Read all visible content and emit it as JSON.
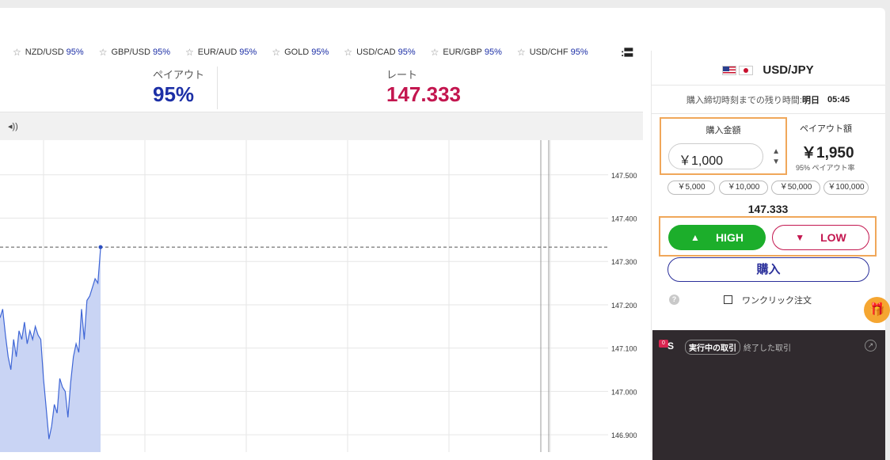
{
  "favorites": [
    {
      "pair": "NZD/USD",
      "payout": "95%"
    },
    {
      "pair": "GBP/USD",
      "payout": "95%"
    },
    {
      "pair": "EUR/AUD",
      "payout": "95%"
    },
    {
      "pair": "GOLD",
      "payout": "95%"
    },
    {
      "pair": "USD/CAD",
      "payout": "95%"
    },
    {
      "pair": "EUR/GBP",
      "payout": "95%"
    },
    {
      "pair": "USD/CHF",
      "payout": "95%"
    }
  ],
  "icons": {
    "star": "☆",
    "menu": ":〓",
    "sound": "🔊",
    "help": "?",
    "gift": "🎁"
  },
  "stats": {
    "payout_label": "ペイアウト",
    "payout_value": "95%",
    "rate_label": "レート",
    "rate_value": "147.333"
  },
  "colors": {
    "payout": "#1c2fa6",
    "rate": "#c3164f",
    "high": "#1cae2b",
    "low": "#c3164f",
    "highlight": "#f0a75a"
  },
  "chart_data": {
    "type": "area",
    "y_ticks": [
      "147.500",
      "147.400",
      "147.300",
      "147.200",
      "147.100",
      "147.000",
      "146.900"
    ],
    "ylim": [
      146.86,
      147.58
    ],
    "current_rate": 147.333,
    "series_values": [
      147.17,
      147.19,
      147.13,
      147.08,
      147.05,
      147.12,
      147.08,
      147.14,
      147.12,
      147.16,
      147.11,
      147.14,
      147.12,
      147.15,
      147.13,
      147.12,
      147.03,
      146.96,
      146.89,
      146.92,
      146.97,
      146.95,
      147.03,
      147.01,
      147.0,
      146.94,
      147.02,
      147.08,
      147.11,
      147.09,
      147.19,
      147.12,
      147.21,
      147.22,
      147.24,
      147.26,
      147.25,
      147.33
    ]
  },
  "panel": {
    "pair": "USD/JPY",
    "deadline_label": "購入締切時刻までの残り時間:",
    "deadline_day": "明日",
    "deadline_time": "05:45",
    "amount_title": "購入金額",
    "amount_value": "￥1,000",
    "stepper_up": "▲",
    "stepper_down": "▼",
    "payout_title": "ペイアウト額",
    "payout_value": "￥1,950",
    "payout_rate": "95% ペイアウト率",
    "presets": [
      "￥5,000",
      "￥10,000",
      "￥50,000",
      "￥100,000"
    ],
    "current_rate": "147.333",
    "high_label": "HIGH",
    "high_icon": "▲",
    "low_label": "LOW",
    "low_icon": "▼",
    "buy_label": "購入",
    "oneclick_label": "ワンクリック注文"
  },
  "trades": {
    "badge": "0",
    "icon_letter": "S",
    "tab_active": "実行中の取引",
    "tab_done": "終了した取引",
    "ext_icon": "↗"
  }
}
